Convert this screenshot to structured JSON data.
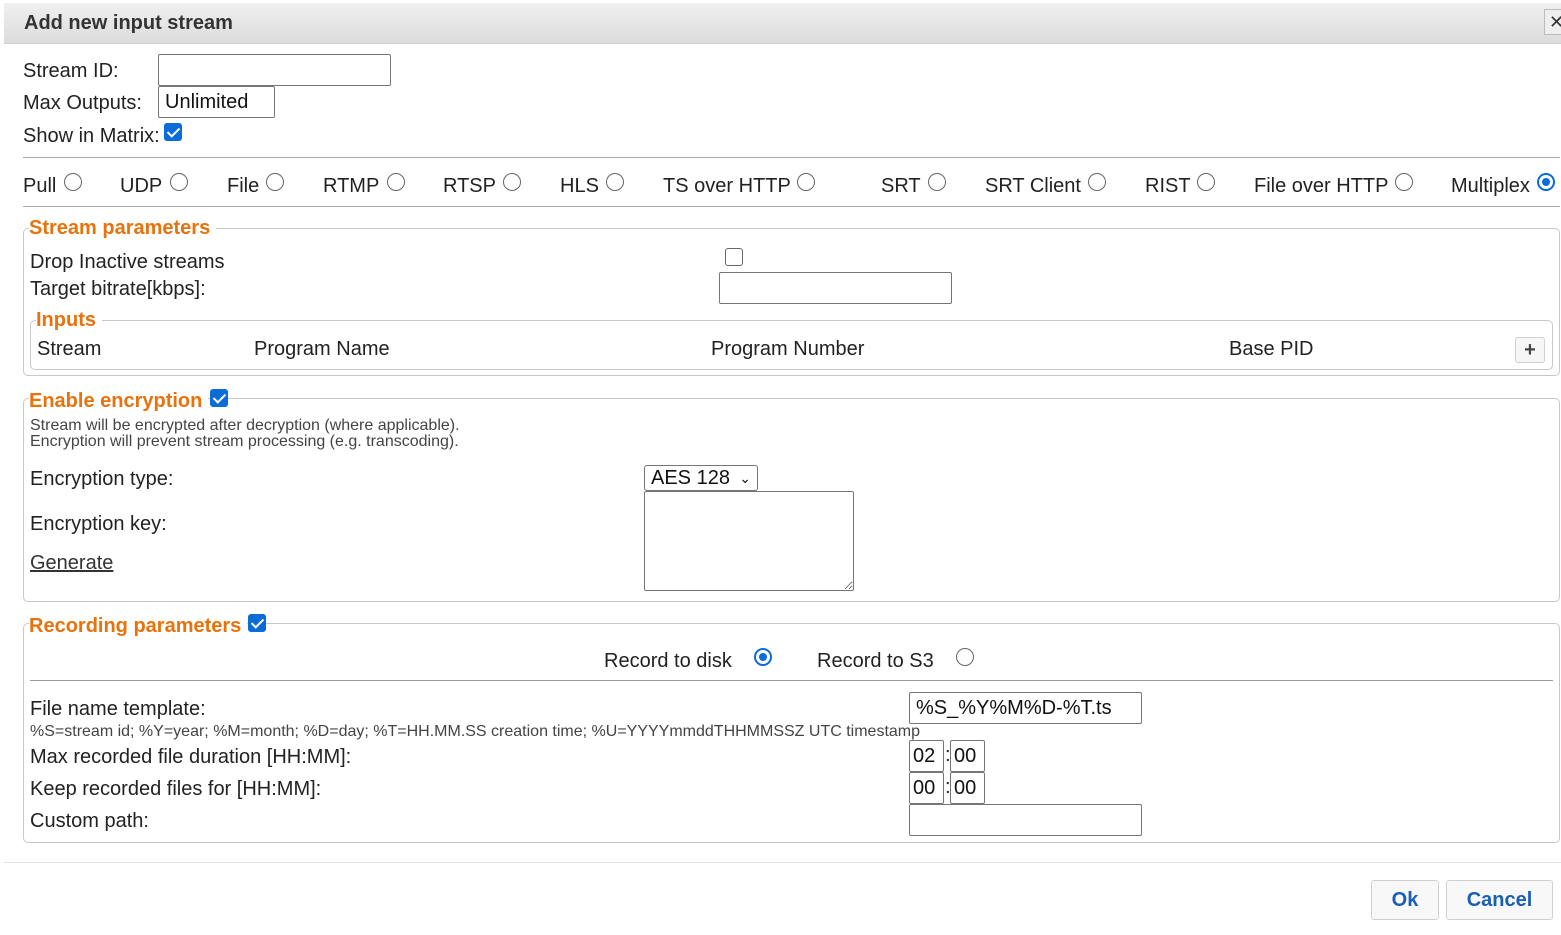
{
  "dialog": {
    "title": "Add new input stream",
    "close_glyph": "✕"
  },
  "general": {
    "stream_id_label": "Stream ID:",
    "stream_id_value": "",
    "max_outputs_label": "Max Outputs:",
    "max_outputs_value": "Unlimited",
    "show_in_matrix_label": "Show in Matrix:",
    "show_in_matrix_checked": true
  },
  "stream_types": [
    {
      "label": "Pull",
      "selected": false
    },
    {
      "label": "UDP",
      "selected": false
    },
    {
      "label": "File",
      "selected": false
    },
    {
      "label": "RTMP",
      "selected": false
    },
    {
      "label": "RTSP",
      "selected": false
    },
    {
      "label": "HLS",
      "selected": false
    },
    {
      "label": "TS over HTTP",
      "selected": false
    },
    {
      "label": "SRT",
      "selected": false
    },
    {
      "label": "SRT Client",
      "selected": false
    },
    {
      "label": "RIST",
      "selected": false
    },
    {
      "label": "File over HTTP",
      "selected": false
    },
    {
      "label": "Multiplex",
      "selected": true
    }
  ],
  "stream_parameters": {
    "legend": "Stream parameters",
    "drop_inactive_label": "Drop Inactive streams",
    "drop_inactive_checked": false,
    "target_bitrate_label": "Target bitrate[kbps]:",
    "target_bitrate_value": "",
    "inputs": {
      "legend": "Inputs",
      "columns": [
        "Stream",
        "Program Name",
        "Program Number",
        "Base PID"
      ],
      "add_glyph": "+"
    }
  },
  "encryption": {
    "legend": "Enable encryption",
    "enabled": true,
    "note_line1": "Stream will be encrypted after decryption (where applicable).",
    "note_line2": "Encryption will prevent stream processing (e.g. transcoding).",
    "type_label": "Encryption type:",
    "type_value": "AES 128",
    "key_label": "Encryption key:",
    "key_value": "",
    "generate_label": "Generate"
  },
  "recording": {
    "legend": "Recording parameters",
    "enabled": true,
    "record_to_disk_label": "Record to disk",
    "record_to_disk_selected": true,
    "record_to_s3_label": "Record to S3",
    "record_to_s3_selected": false,
    "file_name_template_label": "File name template:",
    "file_name_template_value": "%S_%Y%M%D-%T.ts",
    "template_help": "%S=stream id; %Y=year; %M=month; %D=day; %T=HH.MM.SS creation time; %U=YYYYmmddTHHMMSSZ UTC timestamp",
    "max_duration_label": "Max recorded file duration [HH:MM]:",
    "max_duration_hh": "02",
    "max_duration_mm": "00",
    "keep_files_label": "Keep recorded files for [HH:MM]:",
    "keep_files_hh": "00",
    "keep_files_mm": "00",
    "time_separator": ":",
    "custom_path_label": "Custom path:",
    "custom_path_value": ""
  },
  "footer": {
    "ok_label": "Ok",
    "cancel_label": "Cancel"
  },
  "colors": {
    "accent": "#e8720c",
    "checkbox": "#0b6bd8",
    "button_text": "#1a5fb4"
  }
}
